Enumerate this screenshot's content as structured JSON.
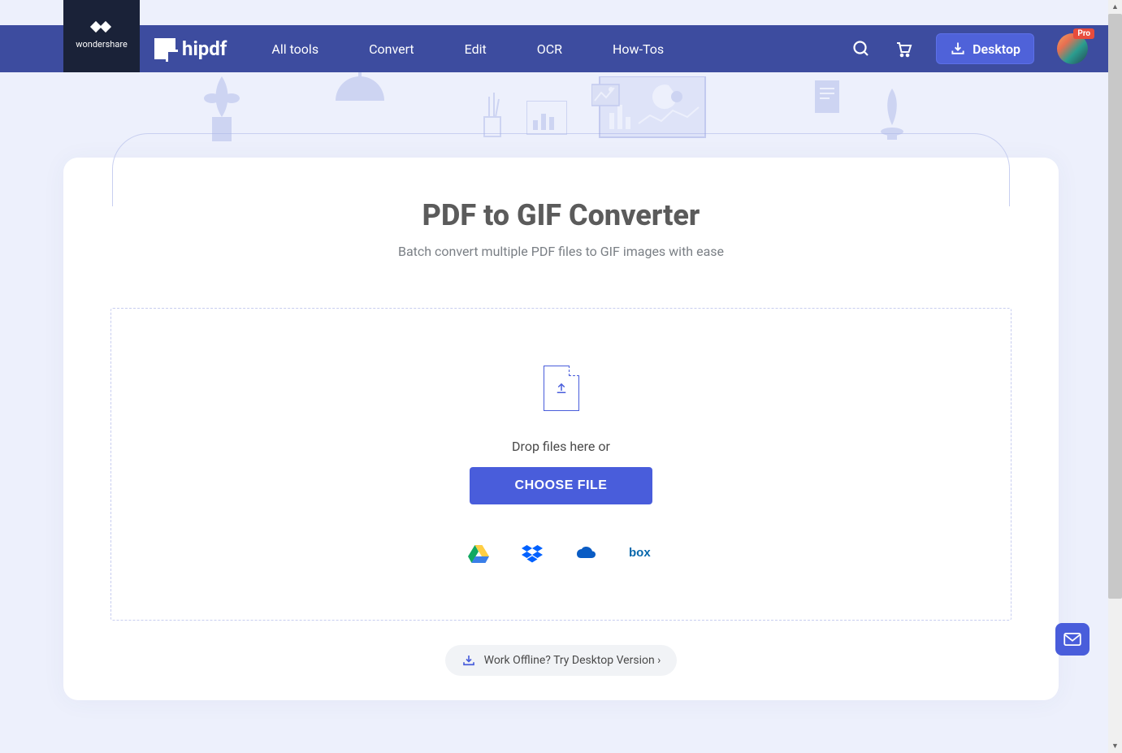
{
  "brand": {
    "wondershare": "wondershare",
    "hipdf": "hipdf"
  },
  "nav": {
    "items": [
      "All tools",
      "Convert",
      "Edit",
      "OCR",
      "How-Tos"
    ]
  },
  "header": {
    "desktop_label": "Desktop",
    "pro_badge": "Pro"
  },
  "page": {
    "title": "PDF to GIF Converter",
    "subtitle": "Batch convert multiple PDF files to GIF images with ease"
  },
  "dropzone": {
    "drop_text": "Drop files here or",
    "choose_file": "CHOOSE FILE"
  },
  "cloud_providers": [
    "google-drive",
    "dropbox",
    "onedrive",
    "box"
  ],
  "offline": {
    "text": "Work Offline? Try Desktop Version ›"
  }
}
